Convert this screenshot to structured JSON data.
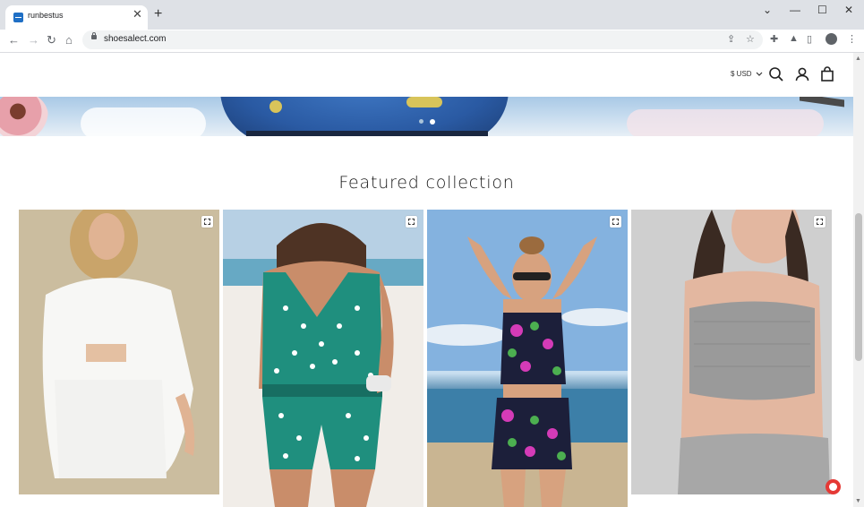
{
  "browser": {
    "tab_title": "runbestus",
    "tab_close": "✕",
    "new_tab": "+",
    "url": "shoesalect.com",
    "window_controls": [
      "⌄",
      "—",
      "☐",
      "✕"
    ],
    "nav": {
      "back": "←",
      "forward": "→",
      "reload": "↻",
      "home": "⌂"
    }
  },
  "header": {
    "currency": "$ USD"
  },
  "banner": {
    "slide_count": 2,
    "active_slide": 2
  },
  "collection": {
    "title": "Featured collection",
    "products": [
      {
        "image": "white linen shirt and shorts set"
      },
      {
        "image": "green polka dot tankini swimsuit"
      },
      {
        "image": "floral print tankini swimsuit"
      },
      {
        "image": "grey ribbed knit crop top set"
      }
    ]
  }
}
